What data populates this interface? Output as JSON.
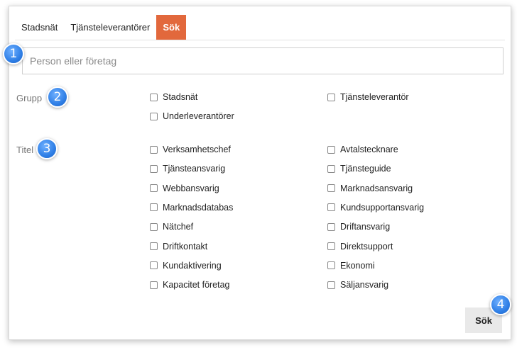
{
  "tabs": [
    {
      "label": "Stadsnät",
      "active": false
    },
    {
      "label": "Tjänsteleverantörer",
      "active": false
    },
    {
      "label": "Sök",
      "active": true
    }
  ],
  "search": {
    "placeholder": "Person eller företag",
    "value": ""
  },
  "groups": {
    "label": "Grupp",
    "options": [
      "Stadsnät",
      "Tjänsteleverantör",
      "Underleverantörer"
    ]
  },
  "titles": {
    "label": "Titel",
    "options": [
      "Verksamhetschef",
      "Avtalstecknare",
      "Tjänsteansvarig",
      "Tjänsteguide",
      "Webbansvarig",
      "Marknadsansvarig",
      "Marknadsdatabas",
      "Kundsupportansvarig",
      "Nätchef",
      "Driftansvarig",
      "Driftkontakt",
      "Direktsupport",
      "Kundaktivering",
      "Ekonomi",
      "Kapacitet företag",
      "Säljansvarig"
    ]
  },
  "submit_label": "Sök",
  "badges": [
    "1",
    "2",
    "3",
    "4"
  ],
  "colors": {
    "accent": "#e2683c",
    "badge": "#2f7fe6"
  }
}
